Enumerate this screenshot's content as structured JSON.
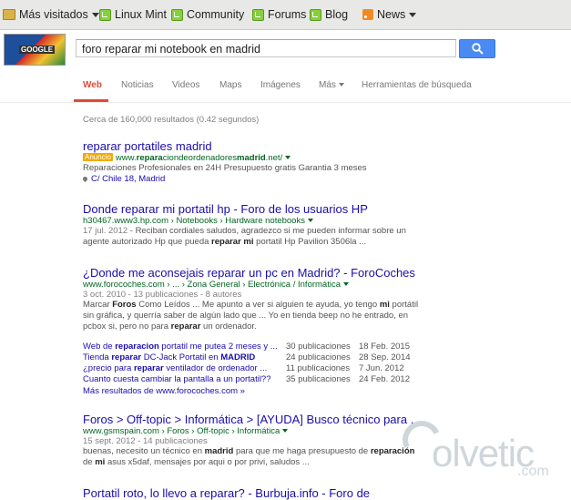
{
  "bookmarks": {
    "most_visited": "Más visitados",
    "linux_mint": "Linux Mint",
    "community": "Community",
    "forums": "Forums",
    "blog": "Blog",
    "news": "News"
  },
  "search": {
    "logo_text": "GOOGLE",
    "query": "foro reparar mi notebook en madrid"
  },
  "tabs": [
    "Web",
    "Noticias",
    "Videos",
    "Maps",
    "Imágenes",
    "Más",
    "Herramientas de búsqueda"
  ],
  "stats": "Cerca de 160,000 resultados (0.42 segundos)",
  "results": {
    "r1": {
      "title": "reparar portatiles madrid",
      "ad_label": "Anuncio",
      "url_pre": "www.",
      "url_b1": "repara",
      "url_mid": "ciondeordenadores",
      "url_b2": "madrid",
      "url_post": ".net/",
      "snippet": "Reparaciones Profesionales en 24H Presupuesto gratis Garantia 3 meses",
      "map_link": "C/ Chile 18, Madrid"
    },
    "r2": {
      "title": "Donde reparar mi portatil hp - Foro de los usuarios HP",
      "url": "h30467.www3.hp.com › Notebooks › Hardware notebooks",
      "date": "17 jul. 2012",
      "snippet_parts": [
        " - Reciban cordiales saludos, agradezco si me pueden informar sobre un agente autorizado Hp que pueda ",
        "reparar",
        " ",
        "mi",
        " portatil Hp Pavilion 3506la ..."
      ]
    },
    "r3": {
      "title": "¿Donde me aconsejais reparar un pc en Madrid? - ForoCoches",
      "url": "www.forocoches.com › ... › Zona General › Electrónica / Informática",
      "meta": "3 oct. 2010 - 13 publicaciones - 8 autores",
      "snippet_parts": [
        "Marcar ",
        "Foros",
        " Como Leídos ... Me apunto a ver si alguien te ayuda, yo tengo ",
        "mi",
        " portátil sin gráfica, y querría saber de algún lado que ... Yo en tienda beep no he entrado, en pcbox si, pero no para ",
        "reparar",
        " un ordenador."
      ],
      "sublinks": [
        {
          "parts": [
            "Web de ",
            "reparacion",
            " portatil me putea 2 meses y ..."
          ],
          "posts": "30 publicaciones",
          "date": "18 Feb. 2015"
        },
        {
          "parts": [
            "Tienda ",
            "reparar",
            " DC-Jack Portatil en ",
            "MADRID"
          ],
          "posts": "24 publicaciones",
          "date": "28 Sep. 2014"
        },
        {
          "parts": [
            "¿precio para ",
            "reparar",
            " ventilador de ordenador ..."
          ],
          "posts": "11 publicaciones",
          "date": "7 Jun. 2012"
        },
        {
          "parts": [
            "Cuanto cuesta cambiar la pantalla a un portatil??"
          ],
          "posts": "35 publicaciones",
          "date": "24 Feb. 2012"
        }
      ],
      "more": "Más resultados de www.forocoches.com »"
    },
    "r4": {
      "title": "Foros > Off-topic > Informática > [AYUDA] Busco técnico para ...",
      "url": "www.gsmspain.com › Foros › Off-topic › Informática",
      "meta": "15 sept. 2012 - 14 publicaciones",
      "snippet_parts": [
        "buenas, necesito un técnico en ",
        "madrid",
        " para que me haga presupuesto de ",
        "reparación",
        " de ",
        "mi",
        " asus x5daf, mensajes por aqui o por privi, saludos ..."
      ]
    },
    "r5": {
      "title": "Portatil roto, lo llevo a reparar? - Burbuja.info - Foro de"
    }
  },
  "watermark": {
    "text": "olvetic",
    "suffix": ".com"
  },
  "colors": {
    "link": "#1a0dab",
    "url": "#006621",
    "active_tab": "#dd4b39",
    "button": "#4a8af4"
  }
}
